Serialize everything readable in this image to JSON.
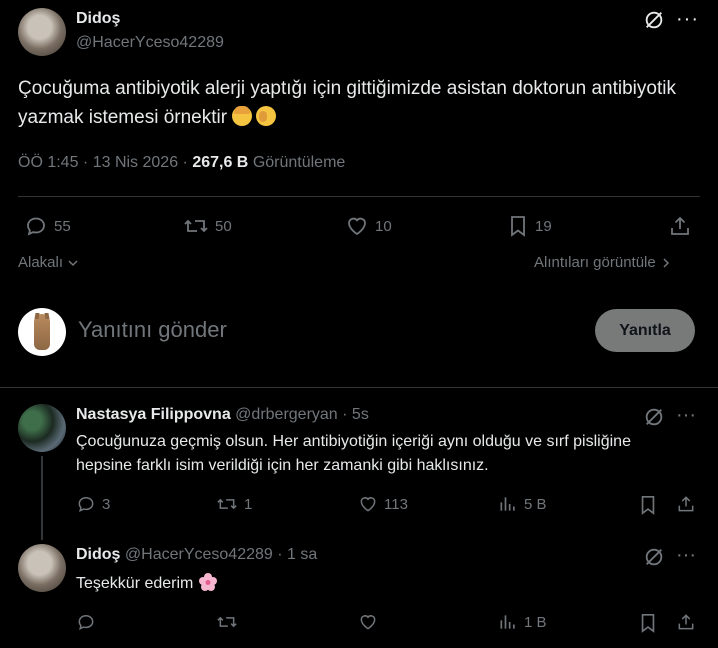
{
  "main_tweet": {
    "display_name": "Didoş",
    "handle": "@HacerYceso42289",
    "text": "Çocuğuma antibiyotik alerji yaptığı için gittiğimizde asistan doktorun antibiyotik yazmak istemesi  örnektir",
    "time": "ÖÖ 1:45 · 13 Nis 2026 · ",
    "views_count": "267,6 B",
    "views_label": "Görüntüleme",
    "replies": "55",
    "retweets": "50",
    "likes": "10",
    "bookmarks": "19",
    "related_label": "Alakalı",
    "quotes_label": "Alıntıları görüntüle"
  },
  "reply_box": {
    "placeholder": "Yanıtını gönder",
    "button_label": "Yanıtla"
  },
  "replies": [
    {
      "display_name": "Nastasya Filippovna",
      "handle": "@drbergeryan",
      "time": "· 5s",
      "text": "Çocuğunuza geçmiş olsun. Her antibiyotiğin içeriği aynı olduğu ve sırf pisliğine hepsine farklı isim verildiği için her zamanki gibi haklısınız.",
      "replies": "3",
      "retweets": "1",
      "likes": "113",
      "views": "5 B"
    },
    {
      "display_name": "Didoş",
      "handle": "@HacerYceso42289",
      "time": "· 1 sa",
      "text": "Teşekkür ederim",
      "replies": "",
      "retweets": "",
      "likes": "",
      "views": "1 B"
    }
  ],
  "icons": {
    "grok": "grok-icon",
    "more": "more-icon",
    "reply": "reply-icon",
    "retweet": "retweet-icon",
    "like": "heart-icon",
    "bookmark": "bookmark-icon",
    "share": "share-icon",
    "views": "views-icon"
  },
  "colors": {
    "background": "#000000",
    "text": "#e7e9ea",
    "muted": "#71767b",
    "divider": "#2f3336",
    "reply_button_bg": "#787a7a"
  }
}
